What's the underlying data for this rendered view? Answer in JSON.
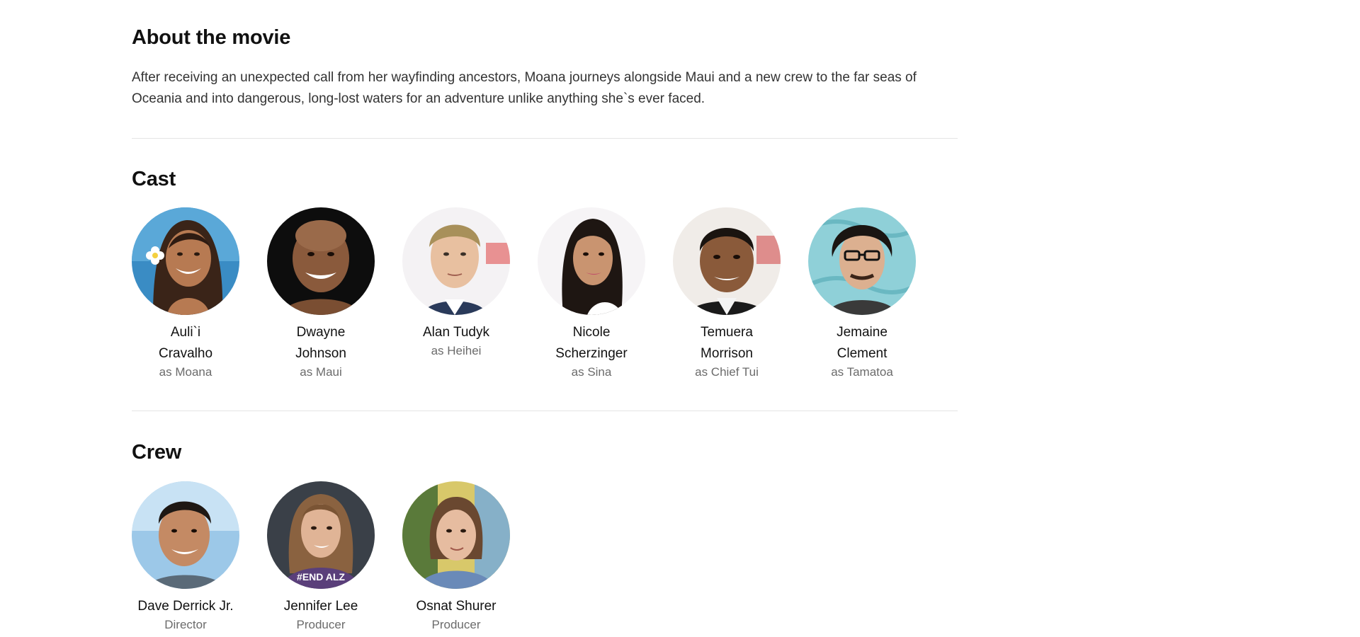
{
  "about": {
    "title": "About the movie",
    "text": "After receiving an unexpected call from her wayfinding ancestors, Moana journeys alongside Maui and a new crew to the far seas of Oceania and into dangerous, long-lost waters for an adventure unlike anything she`s ever faced."
  },
  "cast": {
    "title": "Cast",
    "people": [
      {
        "name": "Auli`i Cravalho",
        "role": "as Moana"
      },
      {
        "name": "Dwayne Johnson",
        "role": "as Maui"
      },
      {
        "name": "Alan Tudyk",
        "role": "as Heihei"
      },
      {
        "name": "Nicole Scherzinger",
        "role": "as Sina"
      },
      {
        "name": "Temuera Morrison",
        "role": "as Chief Tui"
      },
      {
        "name": "Jemaine Clement",
        "role": "as Tamatoa"
      }
    ]
  },
  "crew": {
    "title": "Crew",
    "people": [
      {
        "name": "Dave Derrick Jr.",
        "role": "Director"
      },
      {
        "name": "Jennifer Lee",
        "role": "Producer"
      },
      {
        "name": "Osnat Shurer",
        "role": "Producer"
      }
    ]
  },
  "photo_text": {
    "jennifer_shirt": "#END ALZ"
  }
}
